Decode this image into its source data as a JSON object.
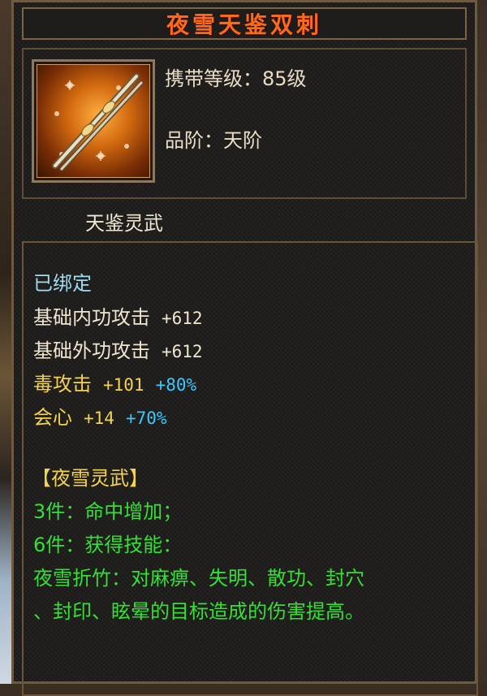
{
  "item": {
    "name": "夜雪天鉴双刺",
    "level_label": "携带等级：85级",
    "grade_label": "品阶：天阶",
    "category": "天鉴灵武"
  },
  "stats": {
    "bound": "已绑定",
    "inner_attack": {
      "label": "基础内功攻击",
      "value": "+612"
    },
    "outer_attack": {
      "label": "基础外功攻击",
      "value": "+612"
    },
    "poison_attack": {
      "label": "毒攻击",
      "value": "+101",
      "bonus": "+80%"
    },
    "crit": {
      "label": "会心",
      "value": "+14",
      "bonus": "+70%"
    }
  },
  "set": {
    "title": "【夜雪灵武】",
    "piece3": "3件：命中增加；",
    "piece6": "6件：获得技能：",
    "skill_line1": "夜雪折竹：对麻痹、失明、散功、封穴",
    "skill_line2": "、封印、眩晕的目标造成的伤害提高。"
  },
  "colors": {
    "title": "#ff6a1a",
    "bound": "#9fdcf0",
    "white_stat": "#f0e6d0",
    "gold_stat": "#f5d34a",
    "bonus": "#3cc8ff",
    "set_text": "#33e033"
  },
  "icon": "twin-dagger-icon"
}
